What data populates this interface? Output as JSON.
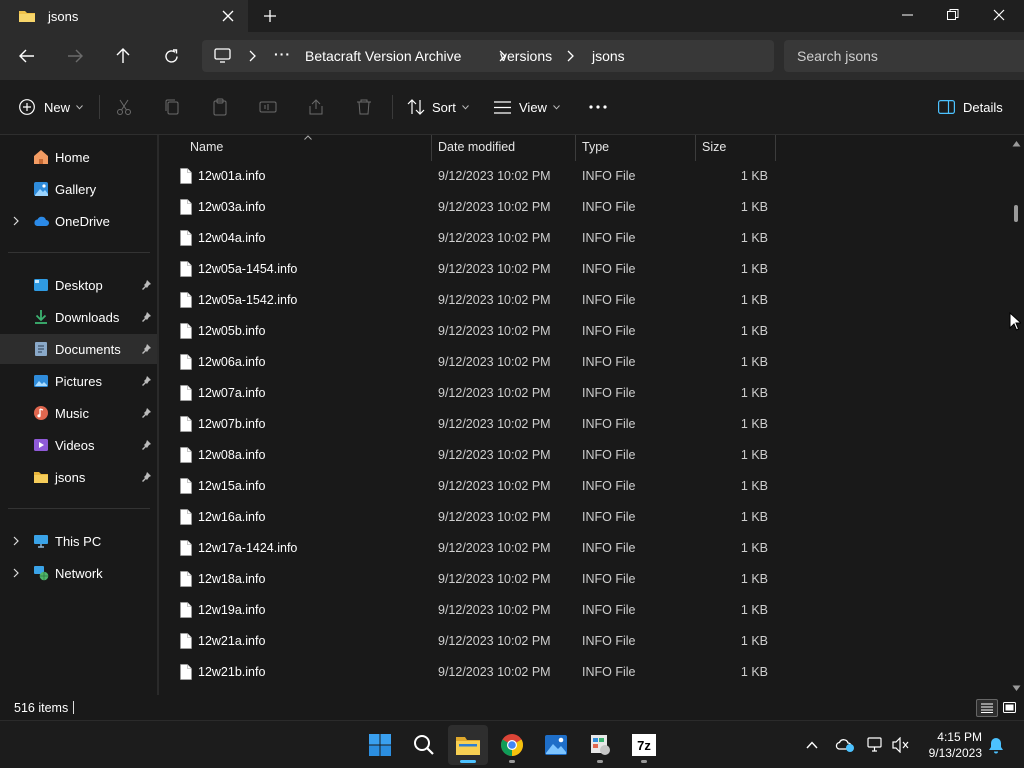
{
  "window": {
    "tab_title": "jsons",
    "new_tab_symbol": "+"
  },
  "address": {
    "overflow_symbol": "···",
    "crumbs": [
      "Betacraft Version Archive",
      "versions",
      "jsons"
    ]
  },
  "search": {
    "placeholder": "Search jsons"
  },
  "toolbar": {
    "new_label": "New",
    "sort_label": "Sort",
    "view_label": "View",
    "details_label": "Details"
  },
  "nav": {
    "home": "Home",
    "gallery": "Gallery",
    "onedrive": "OneDrive",
    "desktop": "Desktop",
    "downloads": "Downloads",
    "documents": "Documents",
    "pictures": "Pictures",
    "music": "Music",
    "videos": "Videos",
    "jsons": "jsons",
    "this_pc": "This PC",
    "network": "Network"
  },
  "columns": {
    "name": "Name",
    "date": "Date modified",
    "type": "Type",
    "size": "Size"
  },
  "files": [
    {
      "name": "12w01a.info",
      "date": "9/12/2023 10:02 PM",
      "type": "INFO File",
      "size": "1 KB"
    },
    {
      "name": "12w03a.info",
      "date": "9/12/2023 10:02 PM",
      "type": "INFO File",
      "size": "1 KB"
    },
    {
      "name": "12w04a.info",
      "date": "9/12/2023 10:02 PM",
      "type": "INFO File",
      "size": "1 KB"
    },
    {
      "name": "12w05a-1454.info",
      "date": "9/12/2023 10:02 PM",
      "type": "INFO File",
      "size": "1 KB"
    },
    {
      "name": "12w05a-1542.info",
      "date": "9/12/2023 10:02 PM",
      "type": "INFO File",
      "size": "1 KB"
    },
    {
      "name": "12w05b.info",
      "date": "9/12/2023 10:02 PM",
      "type": "INFO File",
      "size": "1 KB"
    },
    {
      "name": "12w06a.info",
      "date": "9/12/2023 10:02 PM",
      "type": "INFO File",
      "size": "1 KB"
    },
    {
      "name": "12w07a.info",
      "date": "9/12/2023 10:02 PM",
      "type": "INFO File",
      "size": "1 KB"
    },
    {
      "name": "12w07b.info",
      "date": "9/12/2023 10:02 PM",
      "type": "INFO File",
      "size": "1 KB"
    },
    {
      "name": "12w08a.info",
      "date": "9/12/2023 10:02 PM",
      "type": "INFO File",
      "size": "1 KB"
    },
    {
      "name": "12w15a.info",
      "date": "9/12/2023 10:02 PM",
      "type": "INFO File",
      "size": "1 KB"
    },
    {
      "name": "12w16a.info",
      "date": "9/12/2023 10:02 PM",
      "type": "INFO File",
      "size": "1 KB"
    },
    {
      "name": "12w17a-1424.info",
      "date": "9/12/2023 10:02 PM",
      "type": "INFO File",
      "size": "1 KB"
    },
    {
      "name": "12w18a.info",
      "date": "9/12/2023 10:02 PM",
      "type": "INFO File",
      "size": "1 KB"
    },
    {
      "name": "12w19a.info",
      "date": "9/12/2023 10:02 PM",
      "type": "INFO File",
      "size": "1 KB"
    },
    {
      "name": "12w21a.info",
      "date": "9/12/2023 10:02 PM",
      "type": "INFO File",
      "size": "1 KB"
    },
    {
      "name": "12w21b.info",
      "date": "9/12/2023 10:02 PM",
      "type": "INFO File",
      "size": "1 KB"
    }
  ],
  "status": {
    "item_count": "516 items"
  },
  "taskbar": {
    "sevenzip_label": "7z",
    "time": "4:15 PM",
    "date": "9/13/2023"
  },
  "colors": {
    "accent": "#4cc2ff",
    "folder": "#f0c24b",
    "selected_nav": "#2d2d2d"
  }
}
